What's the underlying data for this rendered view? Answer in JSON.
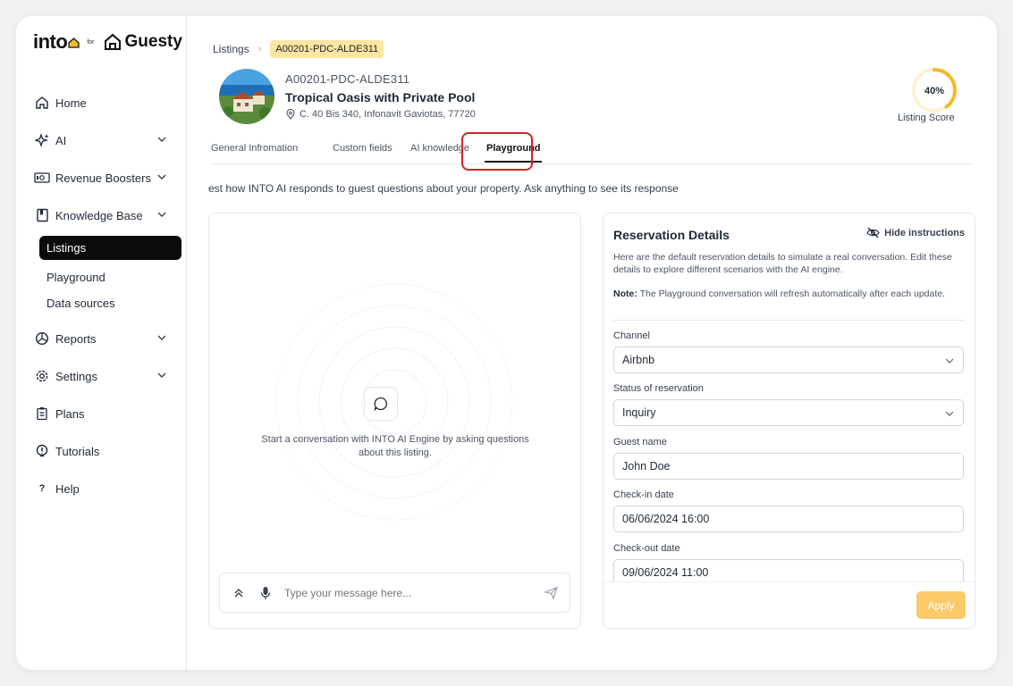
{
  "brand": {
    "into": "into",
    "for": "for",
    "guesty": "Guesty"
  },
  "sidebar": {
    "items": [
      {
        "label": "Home",
        "icon": "home-icon"
      },
      {
        "label": "AI",
        "icon": "sparkle-icon"
      },
      {
        "label": "Revenue Boosters",
        "icon": "money-icon"
      },
      {
        "label": "Knowledge Base",
        "icon": "book-icon"
      },
      {
        "label": "Reports",
        "icon": "pie-chart-icon"
      },
      {
        "label": "Settings",
        "icon": "gear-icon"
      },
      {
        "label": "Plans",
        "icon": "clipboard-icon"
      },
      {
        "label": "Tutorials",
        "icon": "lightbulb-icon"
      },
      {
        "label": "Help",
        "icon": "question-icon"
      }
    ],
    "subitems": [
      {
        "label": "Listings",
        "active": true
      },
      {
        "label": "Playground"
      },
      {
        "label": "Data sources"
      }
    ]
  },
  "breadcrumb": {
    "root": "Listings",
    "current": "A00201-PDC-ALDE311"
  },
  "listing": {
    "code": "A00201-PDC-ALDE311",
    "title": "Tropical Oasis with Private Pool",
    "address": "C. 40 Bis 340, Infonavit Gaviotas, 77720"
  },
  "score": {
    "value_text": "40%",
    "value": 0.4,
    "label": "Listing Score",
    "color": "#f7b928"
  },
  "tabs": [
    {
      "label": "General Infromation"
    },
    {
      "label": "Custom fields"
    },
    {
      "label": "AI knowledge"
    },
    {
      "label": "Playground",
      "active": true
    }
  ],
  "intro": "est how INTO AI responds to guest questions about your property. Ask anything to see its response",
  "chat": {
    "hint": "Start a conversation with INTO AI Engine by asking questions about this listing.",
    "placeholder": "Type your message here..."
  },
  "reservation": {
    "title": "Reservation Details",
    "hide_label": "Hide instructions",
    "description": "Here are the default reservation details to simulate a real conversation. Edit these details to explore different scenarios with the AI engine.",
    "note_label": "Note:",
    "note_text": " The Playground conversation will refresh automatically after each update.",
    "fields": {
      "channel": {
        "label": "Channel",
        "value": "Airbnb"
      },
      "status": {
        "label": "Status of reservation",
        "value": "Inquiry"
      },
      "guest": {
        "label": "Guest name",
        "value": "John Doe"
      },
      "checkin": {
        "label": "Check-in date",
        "value": "06/06/2024 16:00"
      },
      "checkout": {
        "label": "Check-out date",
        "value": "09/06/2024 11:00"
      }
    },
    "apply_label": "Apply"
  },
  "colors": {
    "accent": "#fcc96b",
    "active_nav": "#0b0b0b",
    "highlight": "#d32027",
    "badge": "#fde5a3"
  }
}
